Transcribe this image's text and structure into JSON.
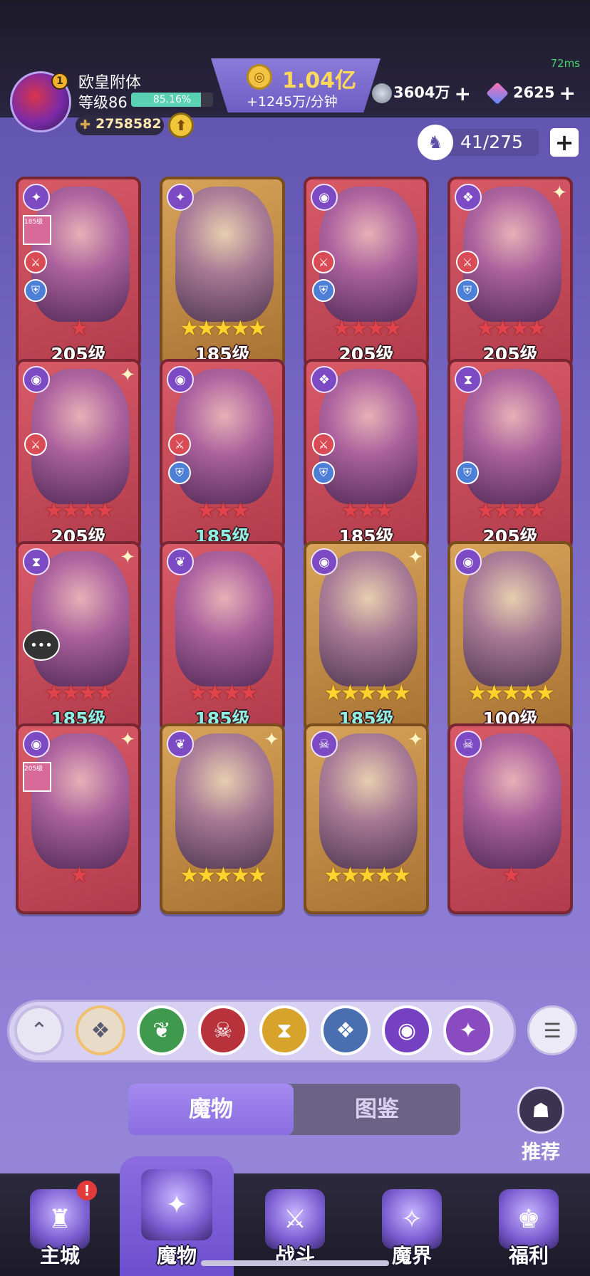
{
  "status": {
    "ping": "72ms"
  },
  "player": {
    "name": "欧皇附体",
    "level_label": "等级86",
    "exp_percent_text": "85.16%",
    "exp_fraction": 0.8516,
    "power": "2758582",
    "vip_badge": "1"
  },
  "currency": {
    "gold_amount": "1.04亿",
    "gold_rate": "+1245万/分钟",
    "silver": "3604万",
    "gems": "2625"
  },
  "roster": {
    "count": "41/275"
  },
  "cards": [
    {
      "level": "205级",
      "stars": 1,
      "star_color": "red",
      "bg": "red",
      "level_teal": false,
      "faction": "✦",
      "roles": [
        "atk",
        "def"
      ],
      "mini": "185级",
      "sparkle": false
    },
    {
      "level": "185级",
      "stars": 5,
      "star_color": "yellow",
      "bg": "gold",
      "level_teal": false,
      "faction": "✦",
      "roles": [],
      "mini": "",
      "sparkle": false
    },
    {
      "level": "205级",
      "stars": 4,
      "star_color": "red",
      "bg": "red",
      "level_teal": false,
      "faction": "◉",
      "roles": [
        "atk",
        "def"
      ],
      "mini": "",
      "sparkle": false
    },
    {
      "level": "205级",
      "stars": 4,
      "star_color": "red",
      "bg": "red",
      "level_teal": false,
      "faction": "❖",
      "roles": [
        "atk",
        "def"
      ],
      "mini": "",
      "sparkle": true
    },
    {
      "level": "205级",
      "stars": 4,
      "star_color": "red",
      "bg": "red",
      "level_teal": false,
      "faction": "◉",
      "roles": [
        "atk"
      ],
      "mini": "",
      "sparkle": true
    },
    {
      "level": "185级",
      "stars": 3,
      "star_color": "red",
      "bg": "red",
      "level_teal": true,
      "faction": "◉",
      "roles": [
        "atk",
        "def"
      ],
      "mini": "",
      "sparkle": false
    },
    {
      "level": "185级",
      "stars": 3,
      "star_color": "red",
      "bg": "red",
      "level_teal": false,
      "faction": "❖",
      "roles": [
        "atk",
        "def"
      ],
      "mini": "",
      "sparkle": false
    },
    {
      "level": "205级",
      "stars": 4,
      "star_color": "red",
      "bg": "red",
      "level_teal": false,
      "faction": "⧗",
      "roles": [
        "def"
      ],
      "mini": "",
      "sparkle": false
    },
    {
      "level": "185级",
      "stars": 4,
      "star_color": "red",
      "bg": "red",
      "level_teal": true,
      "faction": "⧗",
      "roles": [],
      "mini": "",
      "sparkle": true,
      "chat": true
    },
    {
      "level": "185级",
      "stars": 4,
      "star_color": "red",
      "bg": "red",
      "level_teal": true,
      "faction": "❦",
      "roles": [],
      "mini": "",
      "sparkle": false
    },
    {
      "level": "185级",
      "stars": 5,
      "star_color": "yellow",
      "bg": "gold",
      "level_teal": true,
      "faction": "◉",
      "roles": [],
      "mini": "",
      "sparkle": true
    },
    {
      "level": "100级",
      "stars": 5,
      "star_color": "yellow",
      "bg": "gold",
      "level_teal": false,
      "faction": "◉",
      "roles": [],
      "mini": "",
      "sparkle": false
    },
    {
      "level": "",
      "stars": 1,
      "star_color": "red",
      "bg": "red",
      "level_teal": false,
      "faction": "◉",
      "roles": [],
      "mini": "205级",
      "sparkle": true
    },
    {
      "level": "",
      "stars": 5,
      "star_color": "yellow",
      "bg": "gold",
      "level_teal": false,
      "faction": "❦",
      "roles": [],
      "mini": "",
      "sparkle": true
    },
    {
      "level": "",
      "stars": 5,
      "star_color": "yellow",
      "bg": "gold",
      "level_teal": false,
      "faction": "☠",
      "roles": [],
      "mini": "",
      "sparkle": true
    },
    {
      "level": "",
      "stars": 1,
      "star_color": "red",
      "bg": "red",
      "level_teal": false,
      "faction": "☠",
      "roles": [],
      "mini": "",
      "sparkle": false
    }
  ],
  "filters": [
    {
      "name": "collapse-filter-icon",
      "glyph": "⌃",
      "color": "#e9e6f4"
    },
    {
      "name": "all-factions-icon",
      "glyph": "❖",
      "color": "#e8dcc8"
    },
    {
      "name": "nature-faction-icon",
      "glyph": "❦",
      "color": "#3f9a4e"
    },
    {
      "name": "demon-faction-icon",
      "glyph": "☠",
      "color": "#b8323c"
    },
    {
      "name": "hourglass-faction-icon",
      "glyph": "⧗",
      "color": "#d8a32a"
    },
    {
      "name": "dragon-faction-icon",
      "glyph": "❖",
      "color": "#4a6fb0"
    },
    {
      "name": "eye-faction-icon",
      "glyph": "◉",
      "color": "#7640c2"
    },
    {
      "name": "rune-faction-icon",
      "glyph": "✦",
      "color": "#8a4ac0"
    }
  ],
  "tabs": {
    "monsters": "魔物",
    "codex": "图鉴"
  },
  "recommend_label": "推荐",
  "nav": [
    {
      "label": "主城",
      "glyph": "♜",
      "alert": "!"
    },
    {
      "label": "魔物",
      "glyph": "✦",
      "alert": ""
    },
    {
      "label": "战斗",
      "glyph": "⚔",
      "alert": ""
    },
    {
      "label": "魔界",
      "glyph": "✧",
      "alert": ""
    },
    {
      "label": "福利",
      "glyph": "♚",
      "alert": ""
    }
  ]
}
